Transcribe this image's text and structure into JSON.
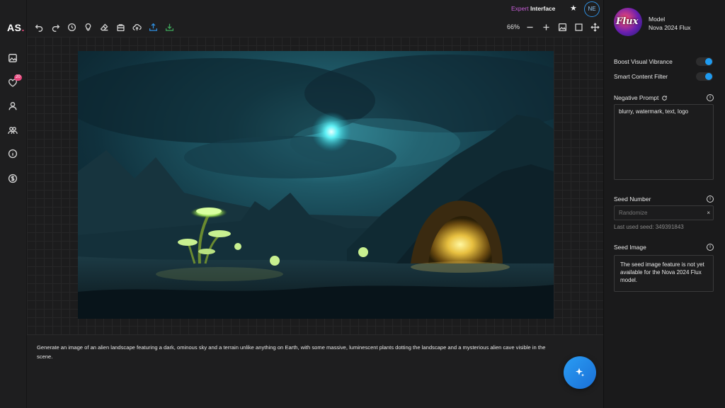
{
  "app": {
    "logo_text": "AS",
    "logo_dot": "."
  },
  "rail": {
    "items": [
      {
        "icon": "image-icon"
      },
      {
        "icon": "heart-icon",
        "badge": "20"
      },
      {
        "icon": "user-icon"
      },
      {
        "icon": "users-icon"
      },
      {
        "icon": "info-icon"
      },
      {
        "icon": "dollar-icon"
      }
    ]
  },
  "header": {
    "expert_word": "Expert",
    "interface_word": "Interface",
    "star": "★",
    "user_initials": "NE",
    "zoom": "66%"
  },
  "prompt": {
    "text": "Generate an image of an alien landscape featuring a dark, ominous sky and a terrain unlike anything on Earth, with some massive, luminescent plants dotting the landscape and a mysterious alien cave visible in the scene."
  },
  "panel": {
    "model_logo_text": "Flux",
    "model_label": "Model",
    "model_name": "Nova 2024 Flux",
    "boost_label": "Boost Visual Vibrance",
    "boost_on": true,
    "filter_label": "Smart Content Filter",
    "filter_on": true,
    "negative_label": "Negative Prompt",
    "negative_value": "blurry, watermark, text, logo",
    "seed_label": "Seed Number",
    "seed_placeholder": "Randomize",
    "seed_clear": "×",
    "last_seed": "Last used seed: 349391843",
    "seed_image_label": "Seed Image",
    "seed_image_text": "The seed image feature is not yet available for the Nova 2024 Flux model.",
    "info_glyph": "i"
  },
  "colors": {
    "accent_blue": "#1f9bf0",
    "expert_purple": "#c85fd8",
    "badge_pink": "#e8467c"
  }
}
